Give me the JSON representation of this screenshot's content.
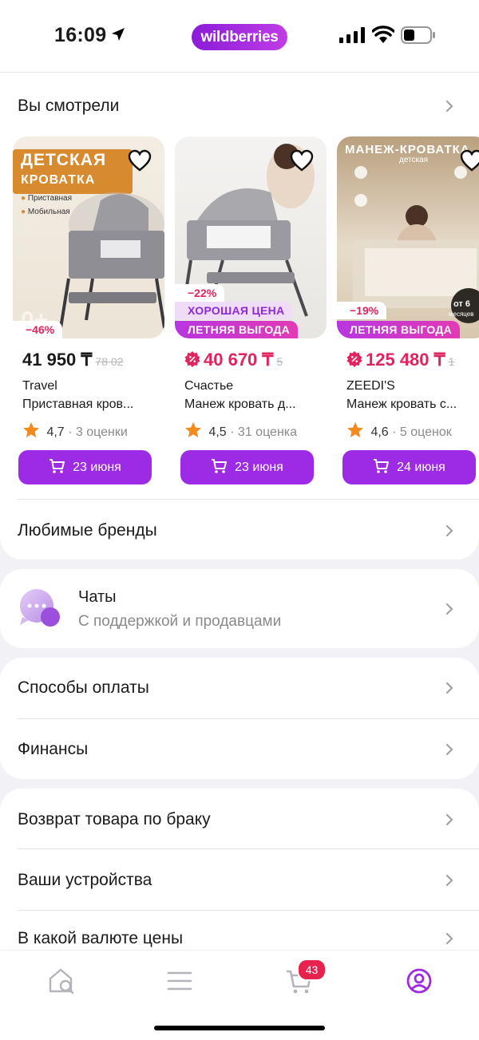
{
  "status_bar": {
    "time": "16:09",
    "brand": "wildberries"
  },
  "viewed": {
    "title": "Вы смотрели",
    "products": [
      {
        "image_text_1": "ДЕТСКАЯ",
        "image_text_2": "КРОВАТКА",
        "image_text_3": "Приставная",
        "image_text_4": "Мобильная",
        "discount": "−46%",
        "price": "41 950 ₸",
        "old_price": "78 02",
        "brand": "Travel",
        "name": "Приставная кров...",
        "rating": "4,7",
        "reviews": "· 3 оценки",
        "buy_label": "23 июня"
      },
      {
        "discount": "−22%",
        "badge_good": "ХОРОШАЯ ЦЕНА",
        "badge_summer": "ЛЕТНЯЯ ВЫГОДА",
        "price": "40 670 ₸",
        "old_price": "5",
        "brand": "Счастье",
        "name": "Манеж кровать д...",
        "rating": "4,5",
        "reviews": "· 31 оценка",
        "buy_label": "23 июня"
      },
      {
        "image_text_1": "МАНЕЖ-КРОВАТКА",
        "image_text_2": "детская",
        "image_text_3": "от 6",
        "image_text_4": "месяцев",
        "discount": "−19%",
        "badge_summer": "ЛЕТНЯЯ ВЫГОДА",
        "price": "125 480 ₸",
        "old_price": "1",
        "brand": "ZEEDI'S",
        "name": "Манеж кровать с...",
        "rating": "4,6",
        "reviews": "· 5 оценок",
        "buy_label": "24 июня"
      }
    ]
  },
  "favorite_brands": "Любимые бренды",
  "chats": {
    "title": "Чаты",
    "subtitle": "С поддержкой и продавцами"
  },
  "payment_methods": "Способы оплаты",
  "finances": "Финансы",
  "defect_return": "Возврат товара по браку",
  "devices": "Ваши устройства",
  "currency": "В какой валюте цены",
  "tabbar": {
    "cart_count": "43"
  },
  "colors": {
    "accent": "#9d2be6",
    "discount": "#e0245e",
    "badge": "#e8224f",
    "star": "#f28a1e"
  }
}
